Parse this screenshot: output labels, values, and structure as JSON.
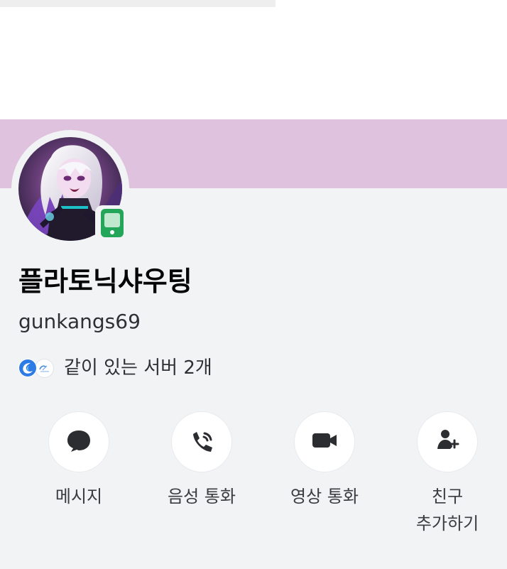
{
  "profile": {
    "display_name": "플라토닉샤우팅",
    "username": "gunkangs69",
    "mutual_servers_text": "같이 있는 서버 2개",
    "status": "mobile-online"
  },
  "theme": {
    "banner_color": "#dec2de",
    "background": "#f2f3f5",
    "status_green": "#23a55a"
  },
  "actions": [
    {
      "label": "메시지",
      "icon": "message-icon"
    },
    {
      "label": "음성 통화",
      "icon": "phone-icon"
    },
    {
      "label": "영상 통화",
      "icon": "video-camera-icon"
    },
    {
      "label": "친구\n추가하기",
      "icon": "add-friend-icon"
    }
  ]
}
